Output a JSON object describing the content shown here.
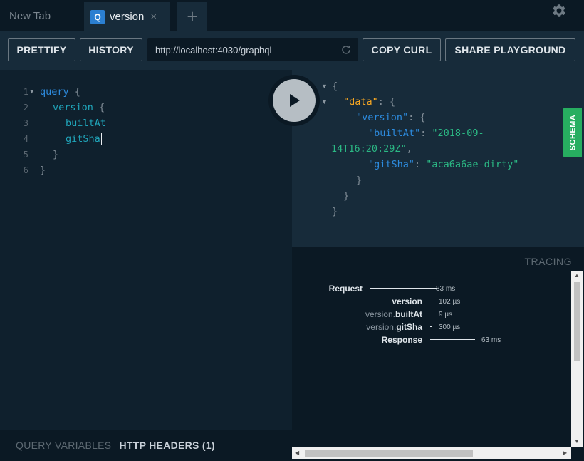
{
  "tabs": [
    {
      "label": "New Tab"
    },
    {
      "label": "version",
      "badge": "Q"
    }
  ],
  "icons": {
    "close": "×",
    "add": "+",
    "settings": "gear-icon",
    "reload": "reload-icon",
    "play": "play-icon"
  },
  "toolbar": {
    "prettify": "PRETTIFY",
    "history": "HISTORY",
    "endpoint": "http://localhost:4030/graphql",
    "copy_curl": "COPY CURL",
    "share": "SHARE PLAYGROUND"
  },
  "editor": {
    "line_numbers": [
      "1",
      "2",
      "3",
      "4",
      "5",
      "6"
    ],
    "lines": {
      "l1_kw": "query",
      "l1_brace": " {",
      "l2_field": "version",
      "l2_brace": " {",
      "l3": "builtAt",
      "l4": "gitSha",
      "l5": "}",
      "l6": "}"
    }
  },
  "bottom": {
    "query_variables": "QUERY VARIABLES",
    "http_headers": "HTTP HEADERS (1)"
  },
  "result": {
    "open": "{",
    "data_key": "\"data\"",
    "colon_brace": ": {",
    "version_key": "\"version\"",
    "builtAt_key": "\"builtAt\"",
    "builtAt_val_1": "\"2018-09-",
    "builtAt_val_2": "14T16:20:29Z\"",
    "comma": ",",
    "colon": ": ",
    "gitSha_key": "\"gitSha\"",
    "gitSha_val": "\"aca6a6ae-dirty\"",
    "close": "}"
  },
  "schema_tab": "SCHEMA",
  "tracing": {
    "title": "TRACING",
    "rows": [
      {
        "prefix": "",
        "name": "Request",
        "duration": "83 ms"
      },
      {
        "prefix": "",
        "name": "version",
        "duration": "102 µs"
      },
      {
        "prefix": "version.",
        "name": "builtAt",
        "duration": "9 µs"
      },
      {
        "prefix": "version.",
        "name": "gitSha",
        "duration": "300 µs"
      },
      {
        "prefix": "",
        "name": "Response",
        "duration": "63 ms"
      }
    ]
  },
  "colors": {
    "keyword": "#2d8bde",
    "field": "#20a5ba",
    "data_key": "#f5a623",
    "string": "#2bb884",
    "schema_tab": "#27ae60",
    "tab_badge": "#2b7fd1"
  }
}
